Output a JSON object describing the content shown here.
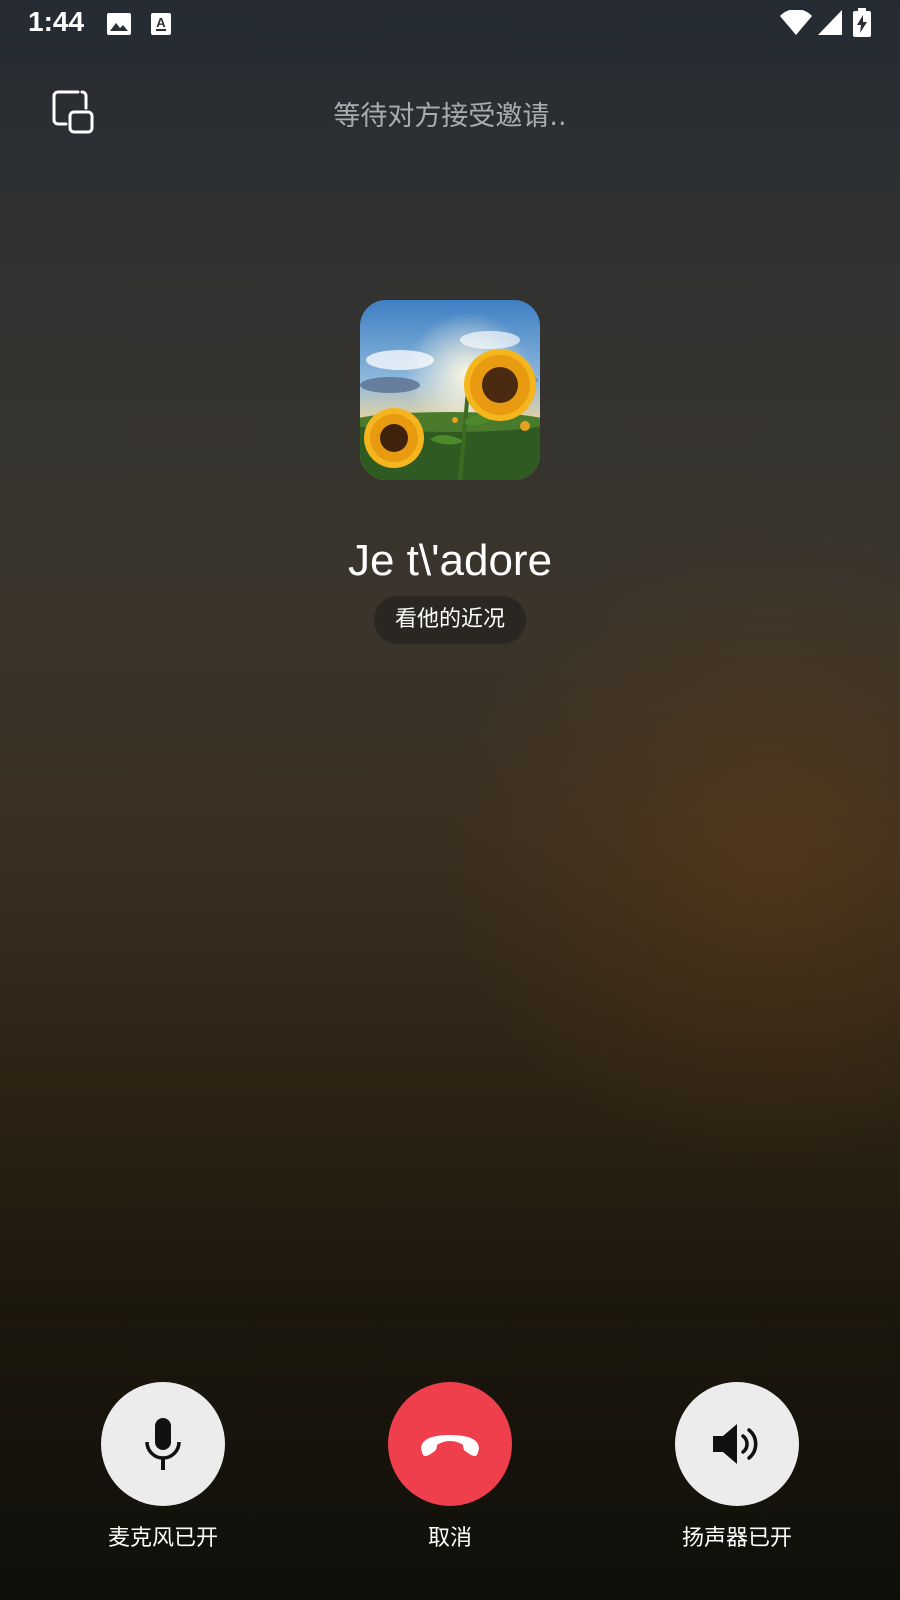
{
  "status_bar": {
    "time": "1:44",
    "left_icons": [
      "image-icon",
      "text-a-icon"
    ],
    "right_icons": [
      "wifi-icon",
      "signal-icon",
      "battery-charging-icon"
    ]
  },
  "header": {
    "pip_icon": "picture-in-picture-icon",
    "call_status": "等待对方接受邀请.."
  },
  "contact": {
    "avatar": "sunflower-field-photo",
    "name": "Je t\\'adore",
    "moments_label": "看他的近况"
  },
  "controls": {
    "mic": {
      "icon": "microphone-icon",
      "label": "麦克风已开"
    },
    "cancel": {
      "icon": "hang-up-icon",
      "label": "取消",
      "color": "#ef3f4c"
    },
    "speaker": {
      "icon": "speaker-icon",
      "label": "扬声器已开"
    }
  }
}
